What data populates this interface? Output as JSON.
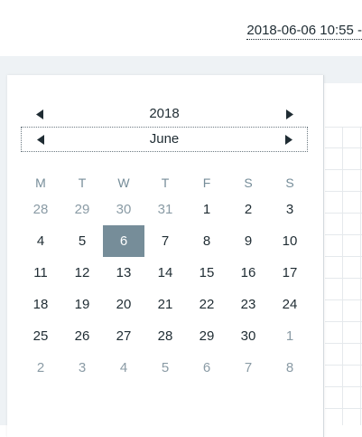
{
  "header": {
    "time_range": "2018-06-06 10:55 -"
  },
  "calendar": {
    "year": "2018",
    "month": "June",
    "weekdays": [
      "M",
      "T",
      "W",
      "T",
      "F",
      "S",
      "S"
    ],
    "weeks": [
      [
        {
          "d": "28",
          "m": true
        },
        {
          "d": "29",
          "m": true
        },
        {
          "d": "30",
          "m": true
        },
        {
          "d": "31",
          "m": true
        },
        {
          "d": "1"
        },
        {
          "d": "2"
        },
        {
          "d": "3"
        }
      ],
      [
        {
          "d": "4"
        },
        {
          "d": "5"
        },
        {
          "d": "6",
          "s": true
        },
        {
          "d": "7"
        },
        {
          "d": "8"
        },
        {
          "d": "9"
        },
        {
          "d": "10"
        }
      ],
      [
        {
          "d": "11"
        },
        {
          "d": "12"
        },
        {
          "d": "13"
        },
        {
          "d": "14"
        },
        {
          "d": "15"
        },
        {
          "d": "16"
        },
        {
          "d": "17"
        }
      ],
      [
        {
          "d": "18"
        },
        {
          "d": "19"
        },
        {
          "d": "20"
        },
        {
          "d": "21"
        },
        {
          "d": "22"
        },
        {
          "d": "23"
        },
        {
          "d": "24"
        }
      ],
      [
        {
          "d": "25"
        },
        {
          "d": "26"
        },
        {
          "d": "27"
        },
        {
          "d": "28"
        },
        {
          "d": "29"
        },
        {
          "d": "30"
        },
        {
          "d": "1",
          "m": true
        }
      ],
      [
        {
          "d": "2",
          "m": true
        },
        {
          "d": "3",
          "m": true
        },
        {
          "d": "4",
          "m": true
        },
        {
          "d": "5",
          "m": true
        },
        {
          "d": "6",
          "m": true
        },
        {
          "d": "7",
          "m": true
        },
        {
          "d": "8",
          "m": true
        }
      ]
    ],
    "icons": {
      "prev": "caret-left-icon",
      "next": "caret-right-icon"
    }
  },
  "colors": {
    "selected_bg": "#768d99",
    "selected_fg": "#ffffff",
    "text": "#1f2c33",
    "muted": "#8a9ba5"
  }
}
